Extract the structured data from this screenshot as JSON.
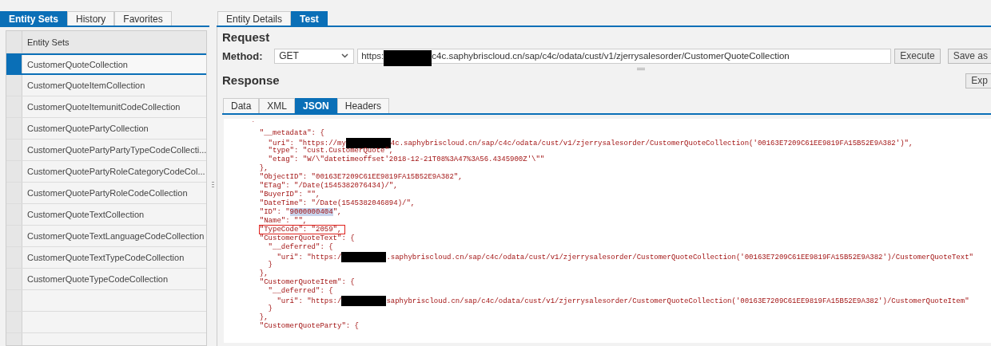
{
  "left_tabs": [
    {
      "label": "Entity Sets",
      "selected": true
    },
    {
      "label": "History",
      "selected": false
    },
    {
      "label": "Favorites",
      "selected": false
    }
  ],
  "entity_table": {
    "header": "Entity Sets",
    "rows": [
      {
        "name": "CustomerQuoteCollection",
        "selected": true
      },
      {
        "name": "CustomerQuoteItemCollection",
        "selected": false
      },
      {
        "name": "CustomerQuoteItemunitCodeCollection",
        "selected": false
      },
      {
        "name": "CustomerQuotePartyCollection",
        "selected": false
      },
      {
        "name": "CustomerQuotePartyPartyTypeCodeCollecti...",
        "selected": false
      },
      {
        "name": "CustomerQuotePartyRoleCategoryCodeCol...",
        "selected": false
      },
      {
        "name": "CustomerQuotePartyRoleCodeCollection",
        "selected": false
      },
      {
        "name": "CustomerQuoteTextCollection",
        "selected": false
      },
      {
        "name": "CustomerQuoteTextLanguageCodeCollection",
        "selected": false
      },
      {
        "name": "CustomerQuoteTextTypeCodeCollection",
        "selected": false
      },
      {
        "name": "CustomerQuoteTypeCodeCollection",
        "selected": false
      }
    ]
  },
  "right_tabs": [
    {
      "label": "Entity Details",
      "selected": false
    },
    {
      "label": "Test",
      "selected": true
    }
  ],
  "request": {
    "title": "Request",
    "method_label": "Method:",
    "method": "GET",
    "url": [
      {
        "kind": "text",
        "text": "https:"
      },
      {
        "kind": "redaction"
      },
      {
        "kind": "text",
        "text": "c4c.saphybriscloud.cn/sap/c4c/odata/cust/v1/zjerrysalesorder/CustomerQuoteCollection"
      }
    ],
    "buttons": [
      "Execute",
      "Save as"
    ]
  },
  "response": {
    "title": "Response",
    "export_button": "Exp",
    "tabs": [
      {
        "label": "Data",
        "selected": false
      },
      {
        "label": "XML",
        "selected": false
      },
      {
        "label": "JSON",
        "selected": true
      },
      {
        "label": "Headers",
        "selected": false
      }
    ],
    "lines": [
      [
        {
          "kind": "text",
          "text": "`"
        }
      ],
      [
        {
          "kind": "text",
          "text": "  \"__metadata\": {"
        }
      ],
      [
        {
          "kind": "text",
          "text": "    \"uri\": \"https://my"
        },
        {
          "kind": "redaction"
        },
        {
          "kind": "text",
          "text": "4c.saphybriscloud.cn/sap/c4c/odata/cust/v1/zjerrysalesorder/CustomerQuoteCollection('00163E7209C61EE9819FA15B52E9A382')\","
        }
      ],
      [
        {
          "kind": "text",
          "text": "    \"type\": \"cust.CustomerQuote\","
        }
      ],
      [
        {
          "kind": "text",
          "text": "    \"etag\": \"W/\\\"datetimeoffset'2018-12-21T08%3A47%3A56.4345900Z'\\\"\""
        }
      ],
      [
        {
          "kind": "text",
          "text": "  },"
        }
      ],
      [
        {
          "kind": "text",
          "text": "  \"ObjectID\": \"00163E7209C61EE9819FA15B52E9A382\","
        }
      ],
      [
        {
          "kind": "text",
          "text": "  \"ETag\": \"/Date(1545382076434)/\","
        }
      ],
      [
        {
          "kind": "text",
          "text": "  \"BuyerID\": \"\","
        }
      ],
      [
        {
          "kind": "text",
          "text": "  \"DateTime\": \"/Date(1545382046894)/\","
        }
      ],
      [
        {
          "kind": "text",
          "text": "  \"ID\": \""
        },
        {
          "kind": "highlight",
          "text": "9000000404"
        },
        {
          "kind": "text",
          "text": "\","
        }
      ],
      [
        {
          "kind": "text",
          "text": "  \"Name\": \"\","
        }
      ],
      [
        {
          "kind": "outlined",
          "text": "\"TypeCode\": \"2059\","
        }
      ],
      [
        {
          "kind": "text",
          "text": "  \"CustomerQuoteText\": {"
        }
      ],
      [
        {
          "kind": "text",
          "text": "    \"__deferred\": {"
        }
      ],
      [
        {
          "kind": "text",
          "text": "      \"uri\": \"https:/"
        },
        {
          "kind": "redaction"
        },
        {
          "kind": "text",
          "text": ".saphybriscloud.cn/sap/c4c/odata/cust/v1/zjerrysalesorder/CustomerQuoteCollection('00163E7209C61EE9819FA15B52E9A382')/CustomerQuoteText\""
        }
      ],
      [
        {
          "kind": "text",
          "text": "    }"
        }
      ],
      [
        {
          "kind": "text",
          "text": "  },"
        }
      ],
      [
        {
          "kind": "text",
          "text": "  \"CustomerQuoteItem\": {"
        }
      ],
      [
        {
          "kind": "text",
          "text": "    \"__deferred\": {"
        }
      ],
      [
        {
          "kind": "text",
          "text": "      \"uri\": \"https:/"
        },
        {
          "kind": "redaction"
        },
        {
          "kind": "text",
          "text": "saphybriscloud.cn/sap/c4c/odata/cust/v1/zjerrysalesorder/CustomerQuoteCollection('00163E7209C61EE9819FA15B52E9A382')/CustomerQuoteItem\""
        }
      ],
      [
        {
          "kind": "text",
          "text": "    }"
        }
      ],
      [
        {
          "kind": "text",
          "text": "  },"
        }
      ],
      [
        {
          "kind": "text",
          "text": "  \"CustomerQuoteParty\": {"
        }
      ]
    ]
  }
}
